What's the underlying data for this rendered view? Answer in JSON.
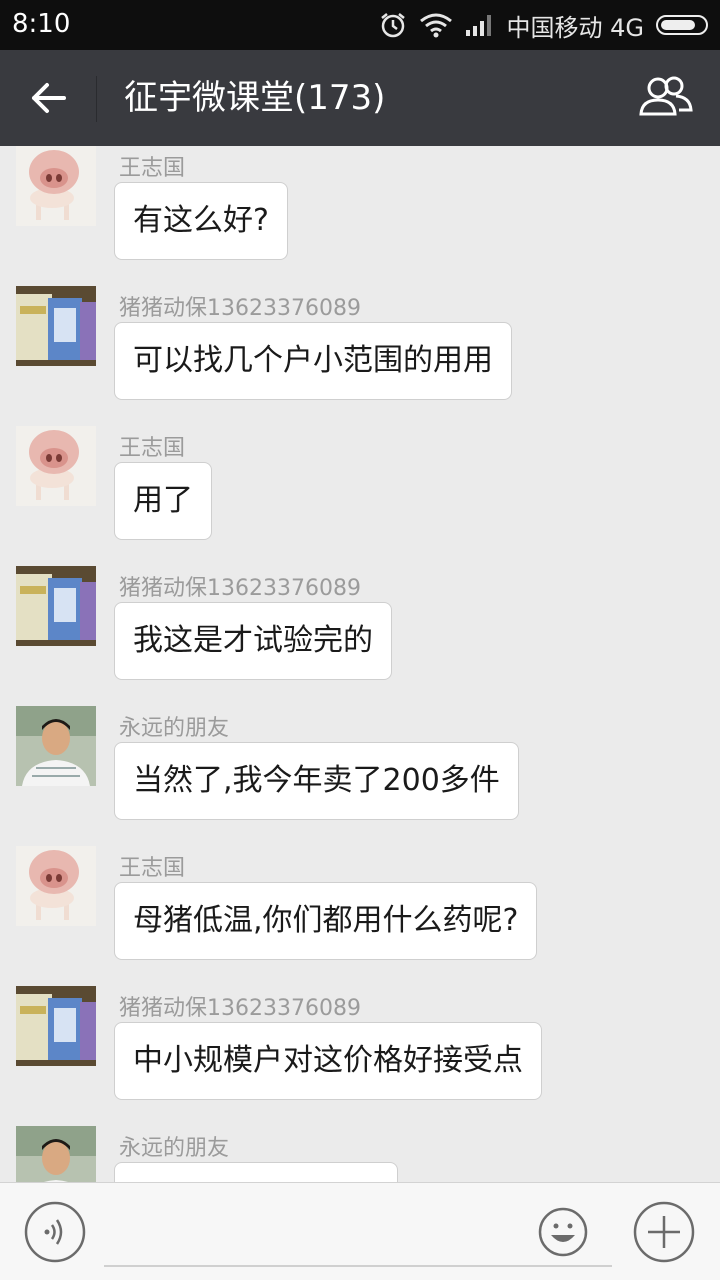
{
  "status_bar": {
    "time": "8:10",
    "carrier": "中国移动 4G",
    "icons": [
      "alarm-icon",
      "wifi-icon",
      "signal-icon",
      "battery-icon"
    ]
  },
  "header": {
    "title": "征宇微课堂(173)",
    "back_icon": "arrow-left-icon",
    "members_icon": "group-members-icon"
  },
  "messages": [
    {
      "sender": "王志国",
      "text": "有这么好?",
      "avatar": "pig-avatar"
    },
    {
      "sender": "猪猪动保13623376089",
      "text": "可以找几个户小范围的用用",
      "avatar": "product-bags-avatar"
    },
    {
      "sender": "王志国",
      "text": "用了",
      "avatar": "pig-avatar"
    },
    {
      "sender": "猪猪动保13623376089",
      "text": "我这是才试验完的",
      "avatar": "product-bags-avatar"
    },
    {
      "sender": "永远的朋友",
      "text": "当然了,我今年卖了200多件",
      "avatar": "man-photo-avatar"
    },
    {
      "sender": "王志国",
      "text": "母猪低温,你们都用什么药呢?",
      "avatar": "pig-avatar"
    },
    {
      "sender": "猪猪动保13623376089",
      "text": "中小规模户对这价格好接受点",
      "avatar": "product-bags-avatar"
    },
    {
      "sender": "永远的朋友",
      "text": "",
      "avatar": "man-photo-avatar"
    }
  ],
  "input_bar": {
    "text_value": "",
    "icons": [
      "voice-icon",
      "emoji-icon",
      "plus-icon"
    ]
  },
  "colors": {
    "status_bar_bg": "#0e0e0e",
    "title_bar_bg": "#393a3f",
    "chat_bg": "#ebebeb",
    "bubble_bg": "#ffffff",
    "sender_text": "#9b9b9b"
  }
}
